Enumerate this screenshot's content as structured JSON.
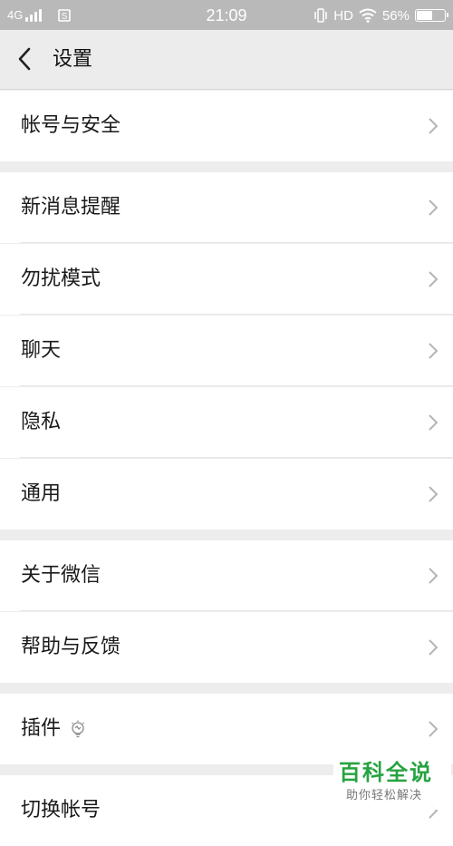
{
  "status_bar": {
    "network": "4G",
    "time": "21:09",
    "hd": "HD",
    "battery": "56%",
    "battery_level": 0.56,
    "icons": [
      "signal-icon",
      "sim-icon",
      "vibrate-icon",
      "wifi-icon",
      "battery-icon"
    ]
  },
  "header": {
    "title": "设置",
    "back_icon": "back-chevron-icon"
  },
  "sections": [
    {
      "items": [
        {
          "label": "帐号与安全"
        }
      ]
    },
    {
      "items": [
        {
          "label": "新消息提醒"
        },
        {
          "label": "勿扰模式"
        },
        {
          "label": "聊天"
        },
        {
          "label": "隐私"
        },
        {
          "label": "通用"
        }
      ]
    },
    {
      "items": [
        {
          "label": "关于微信"
        },
        {
          "label": "帮助与反馈"
        }
      ]
    },
    {
      "items": [
        {
          "label": "插件",
          "icon": "plugin-bulb-icon"
        }
      ]
    },
    {
      "items": [
        {
          "label": "切换帐号"
        }
      ]
    }
  ],
  "watermark": {
    "title": "百科全说",
    "subtitle": "助你轻松解决"
  },
  "colors": {
    "background": "#ededed",
    "status_bar": "#b9b9b9",
    "row": "#ffffff",
    "watermark_green": "#27a341"
  }
}
